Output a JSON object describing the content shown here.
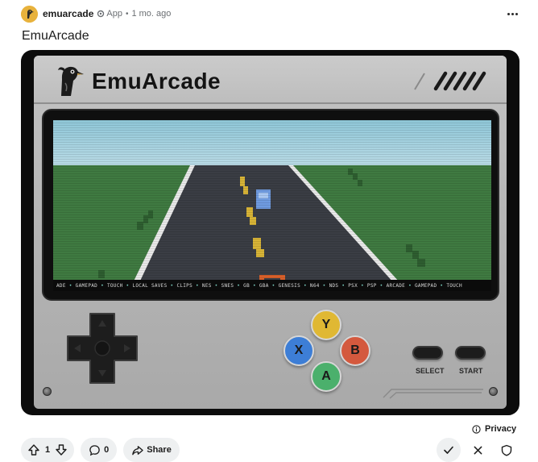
{
  "post": {
    "author": "emuarcade",
    "badge": "App",
    "separator": "•",
    "time": "1 mo. ago",
    "title": "EmuArcade"
  },
  "device": {
    "brand": "EmuArcade",
    "select_label": "SELECT",
    "start_label": "START",
    "buttons": {
      "y": "Y",
      "x": "X",
      "b": "B",
      "a": "A"
    },
    "button_colors": {
      "y": "#e0b833",
      "x": "#3d7ed6",
      "b": "#d4593e",
      "a": "#4bb06c"
    },
    "ticker": [
      "ADE",
      "GAMEPAD",
      "TOUCH",
      "LOCAL SAVES",
      "CLIPS",
      "NES",
      "SNES",
      "GB",
      "GBA",
      "GENESIS",
      "N64",
      "NDS",
      "PSX",
      "PSP",
      "ARCADE",
      "GAMEPAD",
      "TOUCH"
    ]
  },
  "footer": {
    "privacy": "Privacy",
    "upvotes": "1",
    "comments": "0",
    "share": "Share"
  },
  "icons": {
    "avatar": "emu-bird-icon",
    "app": "app-gear-icon",
    "more": "more-horizontal-icon",
    "upvote": "arrow-up-icon",
    "downvote": "arrow-down-icon",
    "comment": "comment-bubble-icon",
    "share": "share-arrow-icon",
    "approve": "checkmark-icon",
    "remove": "close-icon",
    "shield": "shield-icon",
    "info": "info-icon"
  }
}
